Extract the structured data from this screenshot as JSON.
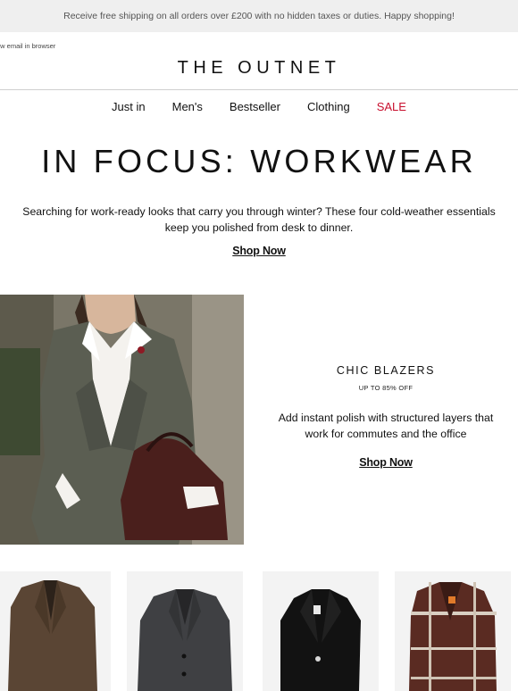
{
  "banner": {
    "text": "Receive free shipping on all orders over £200 with no hidden taxes or duties. Happy shopping!"
  },
  "header": {
    "view_in_browser": "ew email in browser",
    "logo": "THE OUTNET"
  },
  "nav": {
    "items": [
      {
        "label": "Just in"
      },
      {
        "label": "Men's"
      },
      {
        "label": "Bestseller"
      },
      {
        "label": "Clothing"
      },
      {
        "label": "SALE"
      }
    ]
  },
  "hero": {
    "headline": "IN FOCUS: WORKWEAR",
    "intro_line1": "Searching for work-ready looks that carry you through winter? These four cold-weather essentials",
    "intro_line2": "keep you polished from desk to dinner.",
    "cta": "Shop Now"
  },
  "feature": {
    "title": "CHIC BLAZERS",
    "subtitle": "UP TO 85% OFF",
    "desc_line1": "Add instant polish with structured layers that",
    "desc_line2": "work for commutes and the office",
    "cta": "Shop Now"
  },
  "products": [
    {
      "name": "brown-blazer",
      "color": "#5a4534"
    },
    {
      "name": "grey-blazer",
      "color": "#3f4043"
    },
    {
      "name": "black-blazer",
      "color": "#121212"
    },
    {
      "name": "plaid-blazer",
      "color": "#5a2b22"
    }
  ],
  "colors": {
    "sale": "#c8102e",
    "banner_bg": "#efefef"
  }
}
